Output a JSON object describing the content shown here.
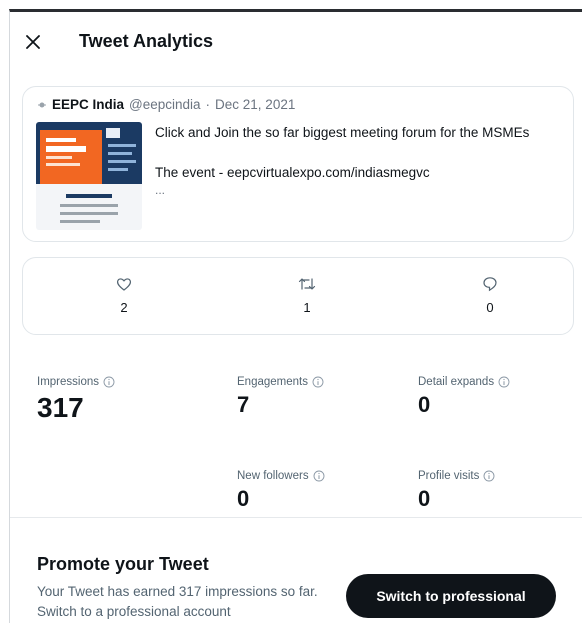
{
  "header": {
    "title": "Tweet Analytics",
    "close_icon": "close-icon"
  },
  "tweet": {
    "author_name": "EEPC India",
    "handle": "@eepcindia",
    "separator": "·",
    "date": "Dec 21, 2021",
    "text_line1": "Click and Join the so far biggest meeting forum for the MSMEs",
    "text_line2": "The event - eepcvirtualexpo.com/indiasmegvc",
    "ellipsis": "...",
    "thumbnail_colors": {
      "primary": "#f26722",
      "dark": "#1b3a63"
    }
  },
  "metrics": {
    "likes": {
      "icon": "heart-icon",
      "value": "2"
    },
    "retweets": {
      "icon": "retweet-icon",
      "value": "1"
    },
    "replies": {
      "icon": "reply-icon",
      "value": "0"
    }
  },
  "stats": {
    "impressions": {
      "label": "Impressions",
      "value": "317"
    },
    "engagements": {
      "label": "Engagements",
      "value": "7"
    },
    "detail_expands": {
      "label": "Detail expands",
      "value": "0"
    },
    "new_followers": {
      "label": "New followers",
      "value": "0"
    },
    "profile_visits": {
      "label": "Profile visits",
      "value": "0"
    }
  },
  "promo": {
    "title": "Promote your Tweet",
    "text": "Your Tweet has earned 317 impressions so far. Switch to a professional account",
    "button_label": "Switch to professional"
  },
  "colors": {
    "text": "#0f1419",
    "muted": "#536471",
    "border": "#e1e6ea",
    "button": "#0f1419"
  }
}
